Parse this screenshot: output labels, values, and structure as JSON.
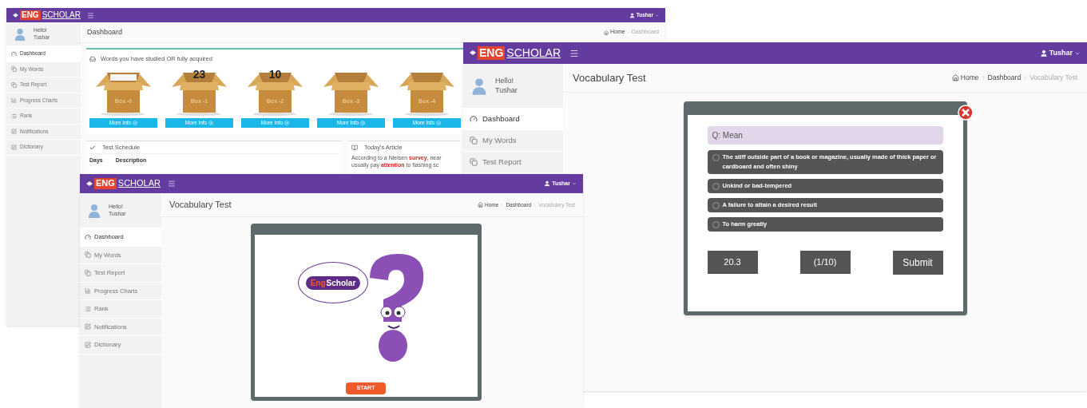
{
  "dashboard_window": {
    "logo": {
      "part_1": "ENG",
      "part_2": "SCHOLAR"
    },
    "user_menu": "Tushar",
    "profile": {
      "greeting": "Hello!",
      "name": "Tushar"
    },
    "sidebar": [
      {
        "label": "Dashboard",
        "selected": true
      },
      {
        "label": "My Words",
        "selected": false
      },
      {
        "label": "Test Report",
        "selected": false
      },
      {
        "label": "Progress Charts",
        "selected": false
      },
      {
        "label": "Rank",
        "selected": false
      },
      {
        "label": "Notifications",
        "selected": false
      },
      {
        "label": "Dictionary",
        "selected": false
      }
    ],
    "page_title": "Dashboard",
    "breadcrumb": [
      "Home",
      "Dashboard"
    ],
    "words_panel": {
      "title": "Words you have studied OR fully acquired",
      "boxes": [
        {
          "kind": "papers",
          "label": "Box -0",
          "button": "More Info"
        },
        {
          "kind": "count",
          "count": "23",
          "label": "Box -1",
          "button": "More Info"
        },
        {
          "kind": "count",
          "count": "10",
          "label": "Box -2",
          "button": "More Info"
        },
        {
          "kind": "empty",
          "label": "Box -3",
          "button": "More Info"
        },
        {
          "kind": "empty",
          "label": "Box -4",
          "button": "More Info"
        }
      ]
    },
    "schedule_panel": {
      "title": "Test Schedule",
      "columns": [
        "Days",
        "Description"
      ]
    },
    "article_panel": {
      "title": "Today's Article",
      "lines": [
        "According to a Nielsen **survey**, near",
        "usually pay **attention** to flashing sc"
      ]
    }
  },
  "test_window": {
    "logo": {
      "part_1": "ENG",
      "part_2": "SCHOLAR"
    },
    "user_menu": "Tushar",
    "profile": {
      "greeting": "Hello!",
      "name": "Tushar"
    },
    "sidebar": [
      {
        "label": "Dashboard",
        "selected": true
      },
      {
        "label": "My Words",
        "selected": false
      },
      {
        "label": "Test Report",
        "selected": false
      }
    ],
    "page_title": "Vocabulary Test",
    "breadcrumb": [
      "Home",
      "Dashboard",
      "Vocabulary Test"
    ],
    "question": "Q: Mean",
    "options": [
      {
        "text": "The stiff outside part of a book or magazine, usually made of thick paper or cardboard and often shiny",
        "selected": false
      },
      {
        "text": "Unkind or bad-tempered",
        "selected": false
      },
      {
        "text": "A failure to attain a desired result",
        "selected": false
      },
      {
        "text": "To harm greatly",
        "selected": false
      }
    ],
    "timer": "20.3",
    "progress": "(1/10)",
    "submit_button": "Submit"
  },
  "start_window": {
    "logo": {
      "part_1": "ENG",
      "part_2": "SCHOLAR"
    },
    "user_menu": "Tushar",
    "profile": {
      "greeting": "Hello!",
      "name": "Tushar"
    },
    "sidebar": [
      {
        "label": "Dashboard",
        "selected": true
      },
      {
        "label": "My Words",
        "selected": false
      },
      {
        "label": "Test Report",
        "selected": false
      },
      {
        "label": "Progress Charts",
        "selected": false
      },
      {
        "label": "Rank",
        "selected": false
      },
      {
        "label": "Notifications",
        "selected": false
      },
      {
        "label": "Dictionary",
        "selected": false
      }
    ],
    "page_title": "Vocabulary Test",
    "breadcrumb": [
      "Home",
      "Dashboard",
      "Vocabulary Test"
    ],
    "mascot_bubble": {
      "part_1": "Eng",
      "part_2": "Scholar"
    },
    "start_button": "START"
  }
}
